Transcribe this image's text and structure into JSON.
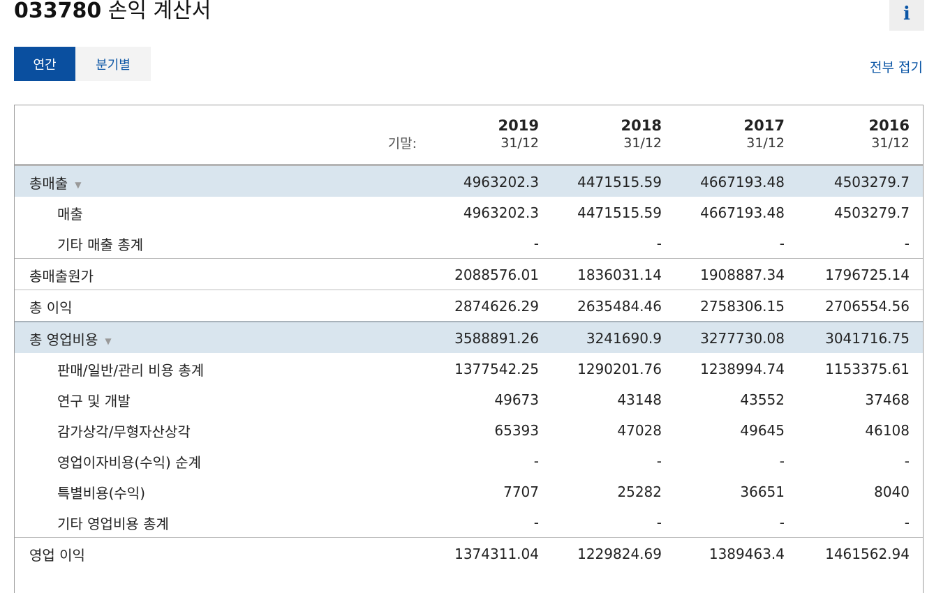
{
  "header": {
    "ticker": "033780",
    "title_rest": "손익 계산서",
    "info_glyph": "i"
  },
  "tabs": [
    {
      "label": "연간",
      "active": true
    },
    {
      "label": "분기별",
      "active": false
    }
  ],
  "collapse_all": "전부 접기",
  "table": {
    "period_label": "기말:",
    "columns": [
      {
        "year": "2019",
        "date": "31/12"
      },
      {
        "year": "2018",
        "date": "31/12"
      },
      {
        "year": "2017",
        "date": "31/12"
      },
      {
        "year": "2016",
        "date": "31/12"
      }
    ],
    "rows": [
      {
        "label": "총매출",
        "level": 0,
        "expandable": true,
        "highlight": true,
        "values": [
          "4963202.3",
          "4471515.59",
          "4667193.48",
          "4503279.7"
        ]
      },
      {
        "label": "매출",
        "level": 1,
        "values": [
          "4963202.3",
          "4471515.59",
          "4667193.48",
          "4503279.7"
        ]
      },
      {
        "label": "기타 매출 총계",
        "level": 1,
        "values": [
          "-",
          "-",
          "-",
          "-"
        ]
      },
      {
        "label": "총매출원가",
        "level": 0,
        "values": [
          "2088576.01",
          "1836031.14",
          "1908887.34",
          "1796725.14"
        ]
      },
      {
        "label": "총 이익",
        "level": 0,
        "values": [
          "2874626.29",
          "2635484.46",
          "2758306.15",
          "2706554.56"
        ]
      },
      {
        "label": "총 영업비용",
        "level": 0,
        "expandable": true,
        "highlight": true,
        "values": [
          "3588891.26",
          "3241690.9",
          "3277730.08",
          "3041716.75"
        ]
      },
      {
        "label": "판매/일반/관리 비용 총계",
        "level": 1,
        "values": [
          "1377542.25",
          "1290201.76",
          "1238994.74",
          "1153375.61"
        ]
      },
      {
        "label": "연구 및 개발",
        "level": 1,
        "values": [
          "49673",
          "43148",
          "43552",
          "37468"
        ]
      },
      {
        "label": "감가상각/무형자산상각",
        "level": 1,
        "values": [
          "65393",
          "47028",
          "49645",
          "46108"
        ]
      },
      {
        "label": "영업이자비용(수익) 순계",
        "level": 1,
        "values": [
          "-",
          "-",
          "-",
          "-"
        ]
      },
      {
        "label": "특별비용(수익)",
        "level": 1,
        "values": [
          "7707",
          "25282",
          "36651",
          "8040"
        ]
      },
      {
        "label": "기타 영업비용 총계",
        "level": 1,
        "values": [
          "-",
          "-",
          "-",
          "-"
        ]
      },
      {
        "label": "영업 이익",
        "level": 0,
        "values": [
          "1374311.04",
          "1229824.69",
          "1389463.4",
          "1461562.94"
        ]
      }
    ]
  }
}
